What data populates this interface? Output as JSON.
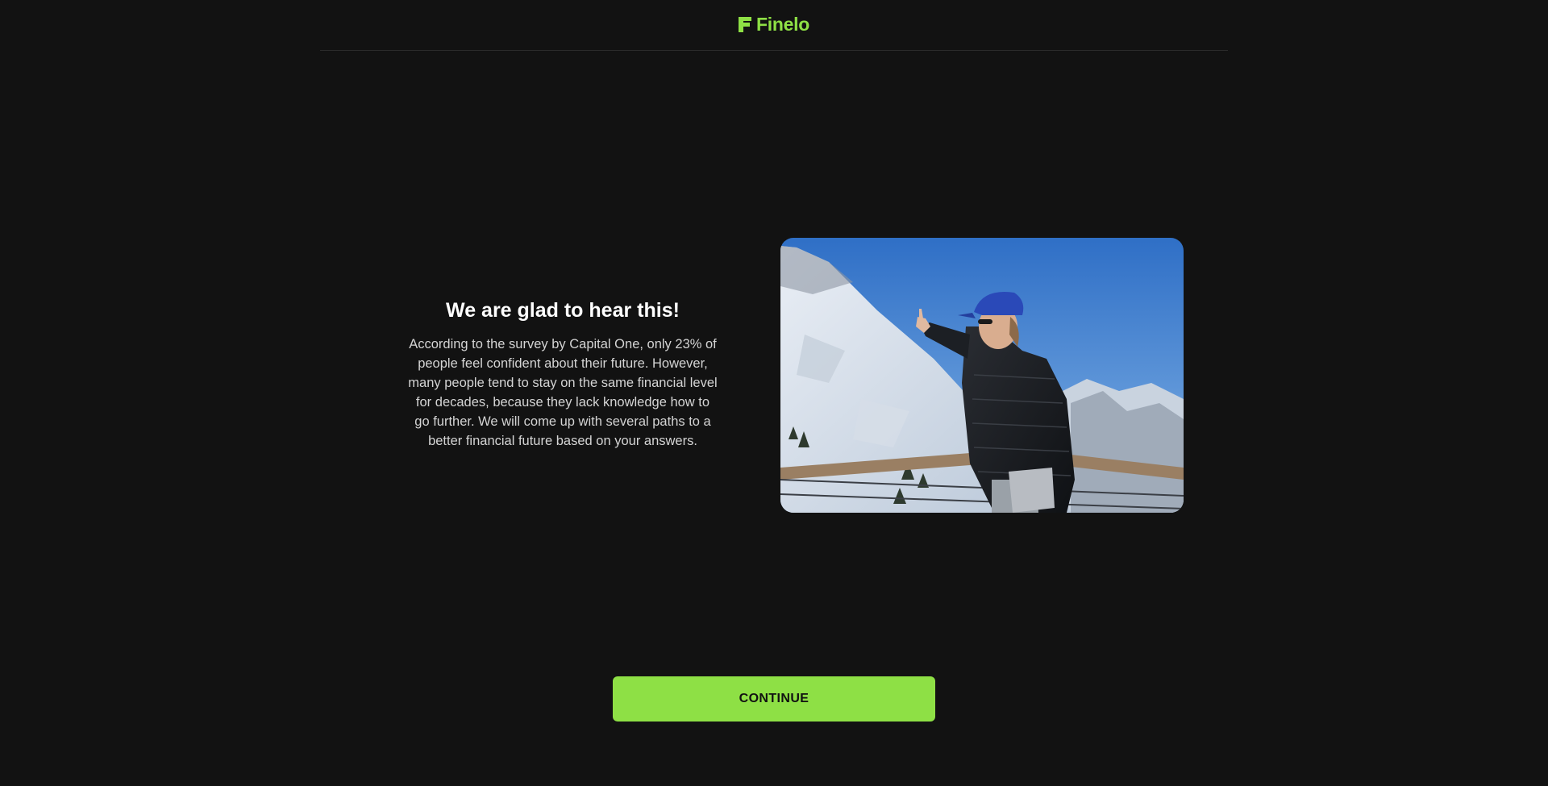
{
  "header": {
    "brand_name": "Finelo",
    "brand_color": "#8ee045",
    "logo_icon": "finelo-f-icon"
  },
  "main": {
    "headline": "We are glad to hear this!",
    "body": "According to the survey by Capital One, only 23% of people feel confident about their future. However, many people tend to stay on the same financial level for decades, because they lack knowledge how to go further. We will come up with several paths to a better financial future based on your answers.",
    "image_subject": "man-in-blue-cap-pointing-at-snowy-mountains"
  },
  "footer": {
    "continue_label": "CONTINUE",
    "button_color": "#8ee045"
  }
}
